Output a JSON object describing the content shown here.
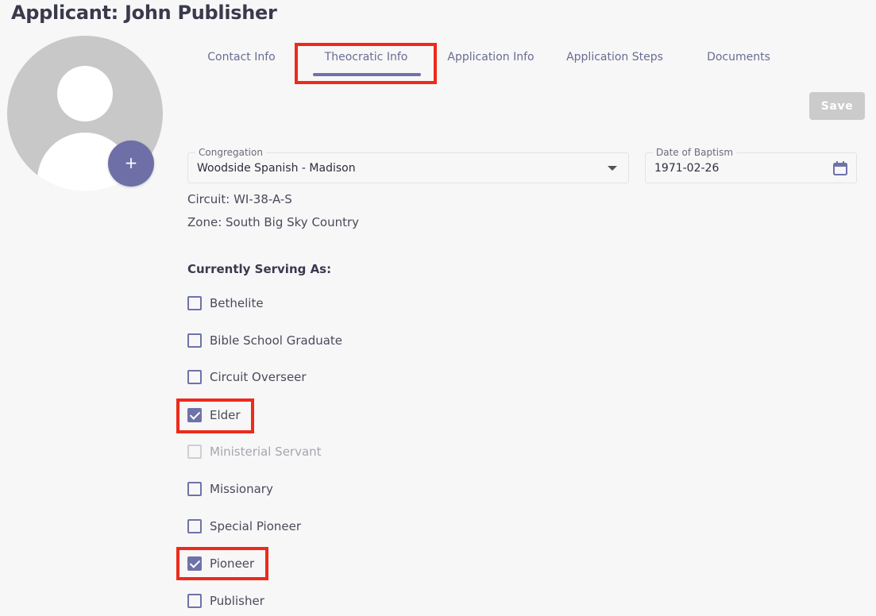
{
  "page_title": "Applicant: John Publisher",
  "avatar": {
    "add_label": "+"
  },
  "tabs": [
    {
      "label": "Contact Info",
      "active": false
    },
    {
      "label": "Theocratic Info",
      "active": true
    },
    {
      "label": "Application Info",
      "active": false
    },
    {
      "label": "Application Steps",
      "active": false
    },
    {
      "label": "Documents",
      "active": false
    }
  ],
  "save_label": "Save",
  "congregation": {
    "label": "Congregation",
    "value": "Woodside Spanish - Madison"
  },
  "baptism": {
    "label": "Date of Baptism",
    "value": "1971-02-26"
  },
  "circuit": "Circuit: WI-38-A-S",
  "zone": "Zone: South Big Sky Country",
  "serving_heading": "Currently Serving As:",
  "serving": [
    {
      "label": "Bethelite",
      "checked": false,
      "disabled": false
    },
    {
      "label": "Bible School Graduate",
      "checked": false,
      "disabled": false
    },
    {
      "label": "Circuit Overseer",
      "checked": false,
      "disabled": false
    },
    {
      "label": "Elder",
      "checked": true,
      "disabled": false
    },
    {
      "label": "Ministerial Servant",
      "checked": false,
      "disabled": true
    },
    {
      "label": "Missionary",
      "checked": false,
      "disabled": false
    },
    {
      "label": "Special Pioneer",
      "checked": false,
      "disabled": false
    },
    {
      "label": "Pioneer",
      "checked": true,
      "disabled": false
    },
    {
      "label": "Publisher",
      "checked": false,
      "disabled": false
    }
  ],
  "colors": {
    "accent": "#6f72a9",
    "highlight": "#ee2a1b",
    "save_disabled": "#cbcbcb"
  }
}
